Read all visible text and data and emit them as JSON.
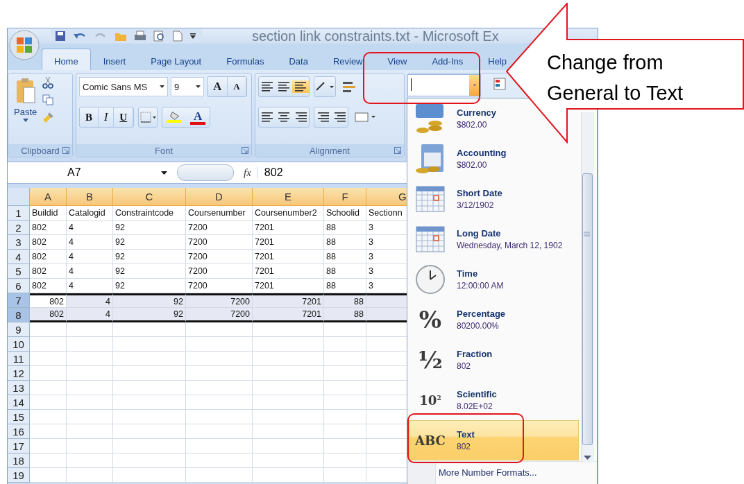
{
  "window": {
    "title": "section link constraints.txt - Microsoft Ex"
  },
  "tabs": [
    {
      "label": "Home",
      "selected": true
    },
    {
      "label": "Insert",
      "selected": false
    },
    {
      "label": "Page Layout",
      "selected": false
    },
    {
      "label": "Formulas",
      "selected": false
    },
    {
      "label": "Data",
      "selected": false
    },
    {
      "label": "Review",
      "selected": false
    },
    {
      "label": "View",
      "selected": false
    },
    {
      "label": "Add-Ins",
      "selected": false
    },
    {
      "label": "Help",
      "selected": false
    }
  ],
  "ribbon": {
    "clipboard": {
      "paste_label": "Paste",
      "group_label": "Clipboard"
    },
    "font": {
      "name": "Comic Sans MS",
      "size": "9",
      "grow_label": "A",
      "shrink_label": "A",
      "style_buttons": [
        "B",
        "I",
        "U"
      ],
      "color_letter": "A",
      "group_label": "Font"
    },
    "alignment": {
      "group_label": "Alignment"
    },
    "number_format_field": {
      "focused": true
    }
  },
  "formula_bar": {
    "name_box": "A7",
    "function_label": "fx",
    "value": "802"
  },
  "sheet": {
    "columns": [
      "A",
      "B",
      "C",
      "D",
      "E",
      "F",
      "G"
    ],
    "rows": [
      {
        "number": "1",
        "kind": "text",
        "selected": false,
        "cells": [
          "Buildid",
          "Catalogid",
          "Constraintcode",
          "Coursenumber",
          "Coursenumber2",
          "Schoolid",
          "Sectionn"
        ]
      },
      {
        "number": "2",
        "kind": "text",
        "selected": false,
        "cells": [
          "802",
          "4",
          "92",
          "7200",
          "7201",
          "88",
          "3"
        ]
      },
      {
        "number": "3",
        "kind": "text",
        "selected": false,
        "cells": [
          "802",
          "4",
          "92",
          "7200",
          "7201",
          "88",
          "3"
        ]
      },
      {
        "number": "4",
        "kind": "text",
        "selected": false,
        "cells": [
          "802",
          "4",
          "92",
          "7200",
          "7201",
          "88",
          "3"
        ]
      },
      {
        "number": "5",
        "kind": "text",
        "selected": false,
        "cells": [
          "802",
          "4",
          "92",
          "7200",
          "7201",
          "88",
          "3"
        ]
      },
      {
        "number": "6",
        "kind": "text",
        "selected": false,
        "cells": [
          "802",
          "4",
          "92",
          "7200",
          "7201",
          "88",
          "3"
        ]
      },
      {
        "number": "7",
        "kind": "number",
        "selected": true,
        "active": true,
        "cells": [
          "802",
          "4",
          "92",
          "7200",
          "7201",
          "88"
        ]
      },
      {
        "number": "8",
        "kind": "number",
        "selected": true,
        "cells": [
          "802",
          "4",
          "92",
          "7200",
          "7201",
          "88"
        ]
      },
      {
        "number": "9"
      },
      {
        "number": "10"
      },
      {
        "number": "11"
      },
      {
        "number": "12"
      },
      {
        "number": "13"
      },
      {
        "number": "14"
      },
      {
        "number": "15"
      },
      {
        "number": "16"
      },
      {
        "number": "17"
      },
      {
        "number": "18"
      },
      {
        "number": "19"
      }
    ]
  },
  "format_menu": {
    "items": [
      {
        "kind": "currency",
        "name": "Currency",
        "sample": "$802.00",
        "selected": false
      },
      {
        "kind": "accounting",
        "name": "Accounting",
        "sample": "$802.00",
        "selected": false
      },
      {
        "kind": "short_date",
        "name": "Short Date",
        "sample": "3/12/1902",
        "selected": false
      },
      {
        "kind": "long_date",
        "name": "Long Date",
        "sample": "Wednesday, March 12, 1902",
        "selected": false
      },
      {
        "kind": "time",
        "name": "Time",
        "sample": "12:00:00 AM",
        "selected": false
      },
      {
        "kind": "symbol",
        "symbol": "%",
        "name": "Percentage",
        "sample": "80200.00%",
        "selected": false
      },
      {
        "kind": "symbol",
        "symbol": "½",
        "name": "Fraction",
        "sample": "802",
        "selected": false
      },
      {
        "kind": "symbol",
        "symbol": "10$^{2}$",
        "name": "Scientific",
        "sample": "8.02E+02",
        "selected": false
      },
      {
        "kind": "symbol",
        "symbol": "ABC",
        "name": "Text",
        "sample": "802",
        "selected": true
      }
    ],
    "footer": "More Number Formats..."
  },
  "callout": {
    "lines": [
      "Change from",
      "General to Text"
    ]
  }
}
